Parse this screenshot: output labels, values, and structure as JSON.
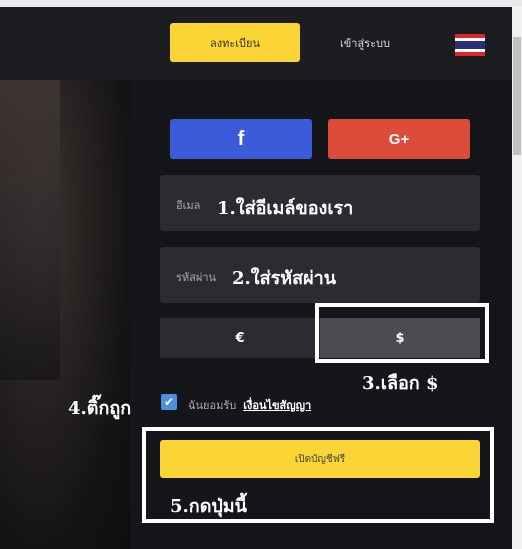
{
  "header": {
    "register_label": "ลงทะเบียน",
    "login_label": "เข้าสู่ระบบ",
    "flag_icon": "thailand-flag-icon"
  },
  "social": {
    "facebook_label": "f",
    "google_label": "G+"
  },
  "form": {
    "email_label": "อีเมล",
    "password_label": "รหัสผ่าน",
    "currency_options": [
      "€",
      "$"
    ],
    "selected_currency": "$",
    "agree_text": "ฉันยอมรับ",
    "agree_link": "เงื่อนไขสัญญา",
    "agree_checked": true,
    "submit_label": "เปิดบัญชีฟรี"
  },
  "annotations": {
    "step1": "1.ใส่อีเมล์ของเรา",
    "step2": "2.ใส่รหัสผ่าน",
    "step3": "3.เลือก $",
    "step4": "4.ติ๊กถูก",
    "step5": "5.กดปุ่มนี้"
  },
  "colors": {
    "accent_yellow": "#fbd435",
    "facebook_blue": "#3b5bdb",
    "google_red": "#dd4b39",
    "checkbox_blue": "#4a8fe0"
  }
}
